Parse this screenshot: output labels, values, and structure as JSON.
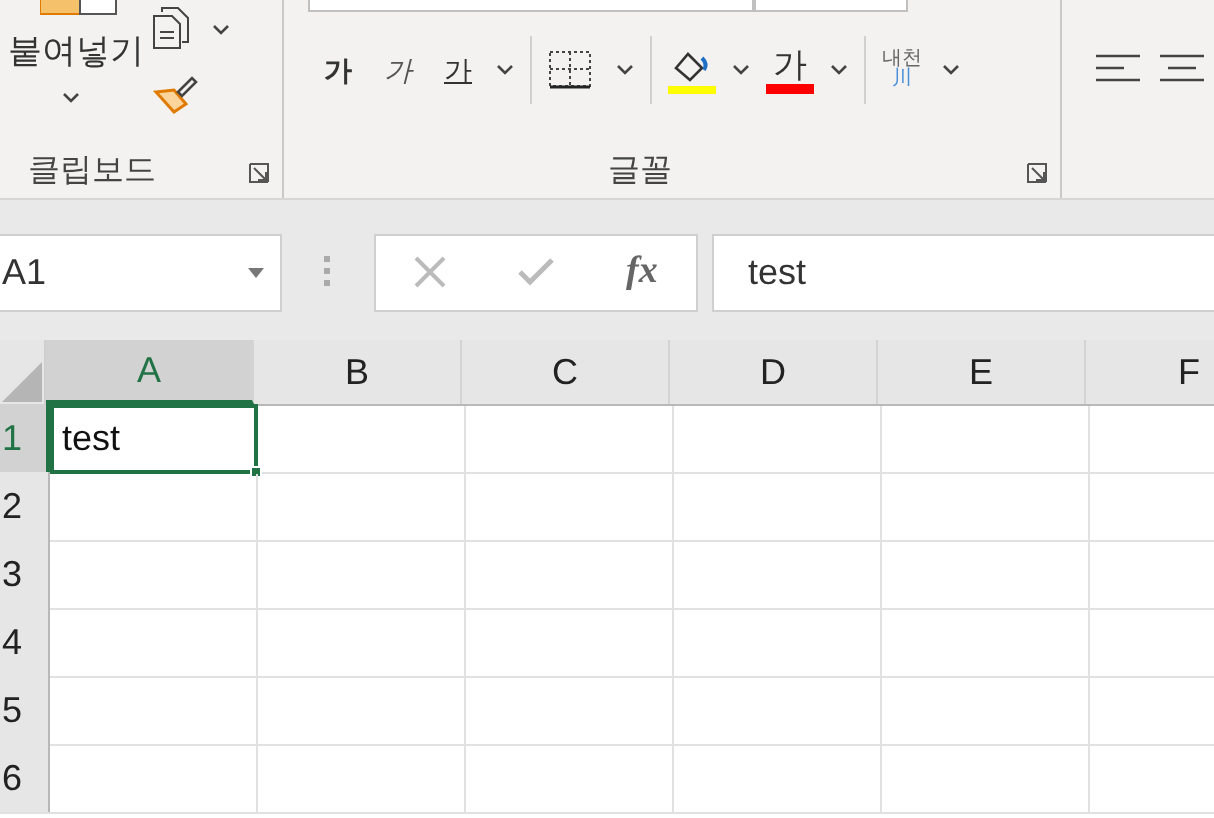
{
  "ribbon": {
    "clipboard": {
      "paste_label": "붙여넣기",
      "group_label": "클립보드"
    },
    "font": {
      "bold": "가",
      "italic": "가",
      "underline": "가",
      "font_color": "가",
      "phonetic_top": "내천",
      "phonetic_bottom": "川",
      "group_label": "글꼴"
    }
  },
  "formula_bar": {
    "name_box": "A1",
    "function_button": "fx",
    "value": "test"
  },
  "sheet": {
    "columns": [
      {
        "label": "A",
        "selected": true
      },
      {
        "label": "B",
        "selected": false
      },
      {
        "label": "C",
        "selected": false
      },
      {
        "label": "D",
        "selected": false
      },
      {
        "label": "E",
        "selected": false
      },
      {
        "label": "F",
        "selected": false
      }
    ],
    "rows": [
      {
        "label": "1",
        "selected": true,
        "cells": [
          {
            "value": "test",
            "selected": true
          }
        ]
      },
      {
        "label": "2",
        "selected": false
      },
      {
        "label": "3",
        "selected": false
      },
      {
        "label": "4",
        "selected": false
      },
      {
        "label": "5",
        "selected": false
      },
      {
        "label": "6",
        "selected": false
      }
    ]
  }
}
